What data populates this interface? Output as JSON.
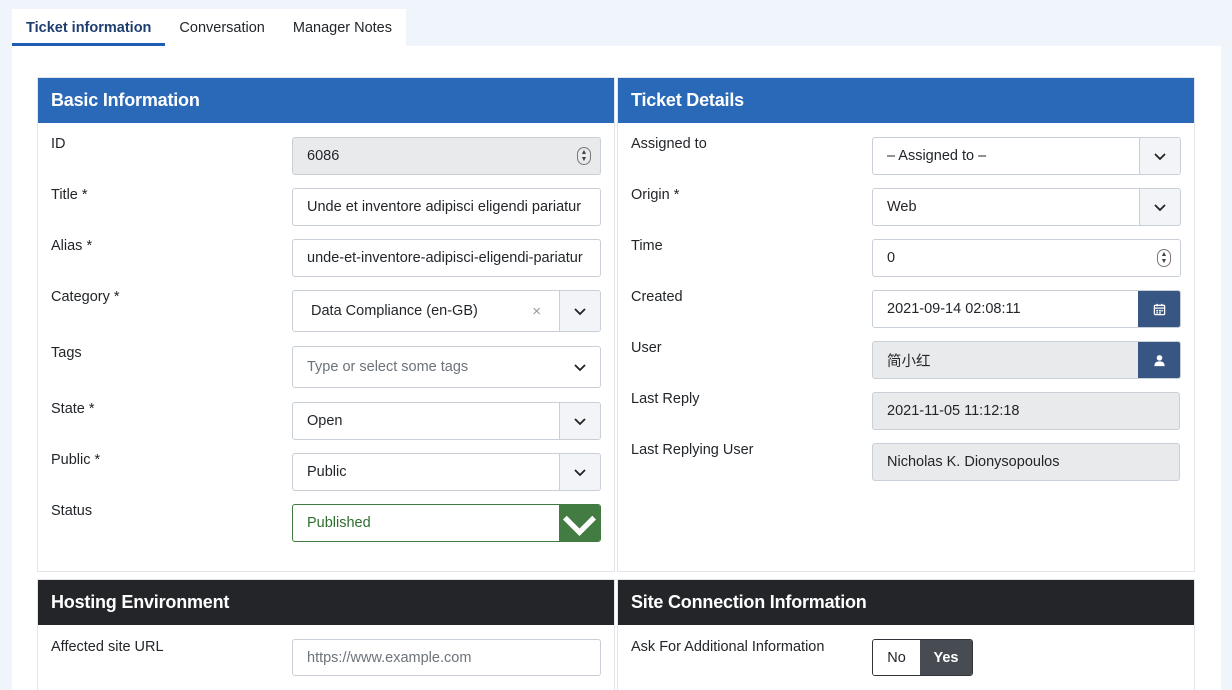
{
  "tabs": [
    {
      "label": "Ticket information"
    },
    {
      "label": "Conversation"
    },
    {
      "label": "Manager Notes"
    }
  ],
  "basic": {
    "title": "Basic Information",
    "id_label": "ID",
    "id_value": "6086",
    "title_label": "Title *",
    "title_value": "Unde et inventore adipisci eligendi pariatur",
    "alias_label": "Alias *",
    "alias_value": "unde-et-inventore-adipisci-eligendi-pariatur",
    "category_label": "Category *",
    "category_value": "Data Compliance (en-GB)",
    "category_clear": "×",
    "tags_label": "Tags",
    "tags_placeholder": "Type or select some tags",
    "state_label": "State *",
    "state_value": "Open",
    "public_label": "Public *",
    "public_value": "Public",
    "status_label": "Status",
    "status_value": "Published"
  },
  "details": {
    "title": "Ticket Details",
    "assigned_label": "Assigned to",
    "assigned_value": "– Assigned to –",
    "origin_label": "Origin *",
    "origin_value": "Web",
    "time_label": "Time",
    "time_value": "0",
    "created_label": "Created",
    "created_value": "2021-09-14 02:08:11",
    "user_label": "User",
    "user_value": "简小红",
    "last_reply_label": "Last Reply",
    "last_reply_value": "2021-11-05 11:12:18",
    "last_user_label": "Last Replying User",
    "last_user_value": "Nicholas K. Dionysopoulos"
  },
  "hosting": {
    "title": "Hosting Environment",
    "site_url_label": "Affected site URL",
    "site_url_placeholder": "https://www.example.com"
  },
  "connection": {
    "title": "Site Connection Information",
    "ask_label": "Ask For Additional Information",
    "no_label": "No",
    "yes_label": "Yes"
  },
  "colors": {
    "primary_header": "#2a69b8",
    "dark_header": "#232529",
    "success": "#437c43",
    "addon_button": "#385684"
  },
  "icons": [
    "chevron-down-icon",
    "calendar-icon",
    "user-icon",
    "spinner-icon"
  ]
}
